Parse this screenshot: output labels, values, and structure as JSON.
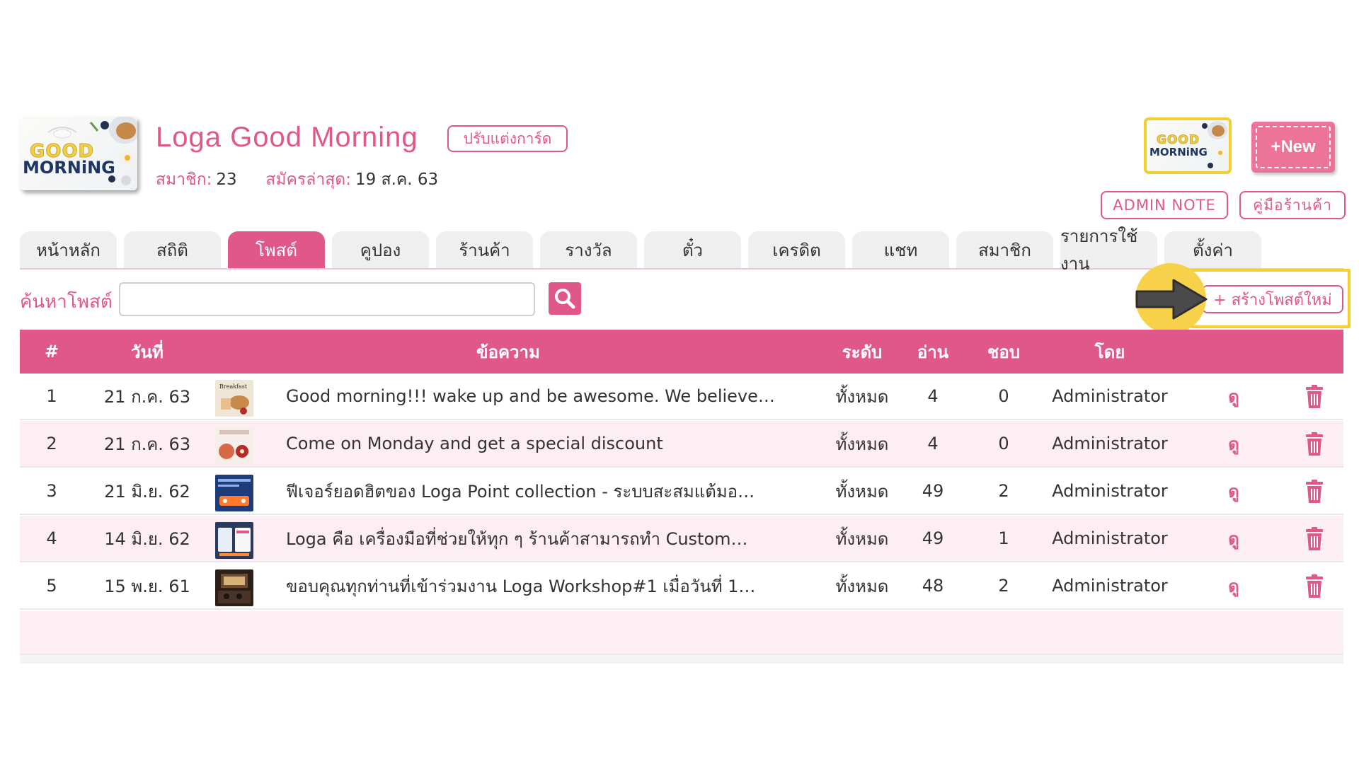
{
  "colors": {
    "brand": "#e0588a",
    "highlight": "#f2cf2e",
    "row_alt": "#fdeef3",
    "tab_inactive": "#efefef"
  },
  "header": {
    "logo": {
      "line1": "GOOD",
      "line2": "MORNiNG"
    },
    "shop_name": "Loga  Good  Morning",
    "edit_card_label": "ปรับแต่งการ์ด",
    "members_label": "สมาชิก:",
    "members_value": "23",
    "last_join_label": "สมัครล่าสุด:",
    "last_join_value": "19 ส.ค. 63",
    "new_button_label": "+New",
    "admin_note_label": "ADMIN  NOTE",
    "shop_manual_label": "คู่มือร้านค้า"
  },
  "tabs": [
    {
      "label": "หน้าหลัก",
      "active": false
    },
    {
      "label": "สถิติ",
      "active": false
    },
    {
      "label": "โพสต์",
      "active": true
    },
    {
      "label": "คูปอง",
      "active": false
    },
    {
      "label": "ร้านค้า",
      "active": false
    },
    {
      "label": "รางวัล",
      "active": false
    },
    {
      "label": "ตั๋ว",
      "active": false
    },
    {
      "label": "เครดิต",
      "active": false
    },
    {
      "label": "แชท",
      "active": false
    },
    {
      "label": "สมาชิก",
      "active": false
    },
    {
      "label": "รายการใช้งาน",
      "active": false
    },
    {
      "label": "ตั้งค่า",
      "active": false
    }
  ],
  "search": {
    "label": "ค้นหาโพสต์",
    "value": "",
    "placeholder": "",
    "button_icon": "search-icon"
  },
  "create_post_label": "+ สร้างโพสต์ใหม่",
  "table": {
    "columns": [
      "#",
      "วันที่",
      "ข้อความ",
      "ระดับ",
      "อ่าน",
      "ชอบ",
      "โดย"
    ],
    "view_label": "ดู",
    "rows": [
      {
        "no": "1",
        "date": "21 ก.ค. 63",
        "message": "Good morning!!! wake up and be awesome. We believe…",
        "level": "ทั้งหมด",
        "reads": "4",
        "likes": "0",
        "by": "Administrator"
      },
      {
        "no": "2",
        "date": "21 ก.ค. 63",
        "message": "Come on Monday and get a special discount",
        "level": "ทั้งหมด",
        "reads": "4",
        "likes": "0",
        "by": "Administrator"
      },
      {
        "no": "3",
        "date": "21 มิ.ย. 62",
        "message": "ฟีเจอร์ยอดฮิตของ Loga Point collection - ระบบสะสมแต้มอ…",
        "level": "ทั้งหมด",
        "reads": "49",
        "likes": "2",
        "by": "Administrator"
      },
      {
        "no": "4",
        "date": "14 มิ.ย. 62",
        "message": "Loga คือ เครื่องมือที่ช่วยให้ทุก ๆ ร้านค้าสามารถทำ Custom…",
        "level": "ทั้งหมด",
        "reads": "49",
        "likes": "1",
        "by": "Administrator"
      },
      {
        "no": "5",
        "date": "15 พ.ย. 61",
        "message": "ขอบคุณทุกท่านที่เข้าร่วมงาน Loga Workshop#1 เมื่อวันที่ 1…",
        "level": "ทั้งหมด",
        "reads": "48",
        "likes": "2",
        "by": "Administrator"
      }
    ]
  }
}
